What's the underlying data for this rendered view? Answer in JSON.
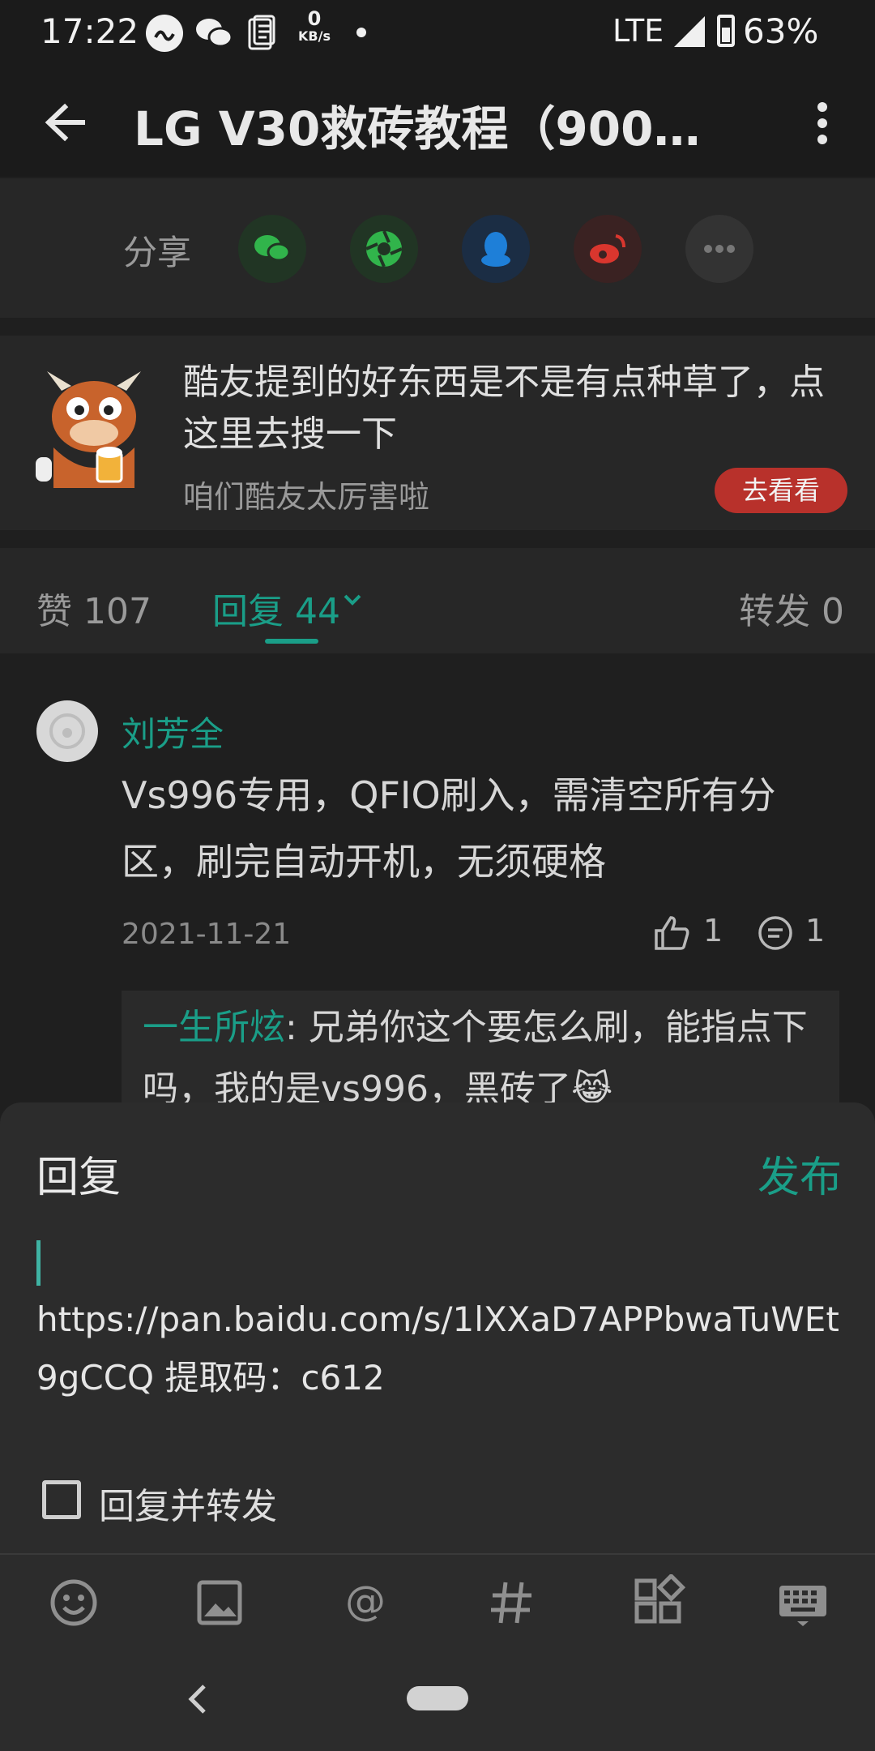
{
  "status_bar": {
    "time": "17:22",
    "net_speed_value": "0",
    "net_speed_unit": "KB/s",
    "network": "LTE",
    "battery": "63%"
  },
  "app_bar": {
    "title": "LG V30救砖教程（9008..."
  },
  "share": {
    "label": "分享",
    "targets": [
      "wechat",
      "moments",
      "qq",
      "weibo",
      "more"
    ]
  },
  "promo": {
    "text": "酷友提到的好东西是不是有点种草了，点这里去搜一下",
    "subtext": "咱们酷友太厉害啦",
    "button": "去看看"
  },
  "tabs": {
    "like": "赞 107",
    "reply": "回复 44",
    "forward": "转发 0"
  },
  "comment": {
    "author": "刘芳全",
    "text": "Vs996专用，QFIO刷入，需清空所有分区，刷完自动开机，无须硬格",
    "date": "2021-11-21",
    "likes": "1",
    "replies": "1",
    "sub_author": "一生所炫",
    "sub_text": ": 兄弟你这个要怎么刷，能指点下吗，我的是vs996，黑砖了😹"
  },
  "reply_sheet": {
    "title": "回复",
    "publish": "发布",
    "input_value": "https://pan.baidu.com/s/1lXXaD7APPbwaTuWEt9gCCQ 提取码：c612",
    "checkbox_label": "回复并转发"
  },
  "colors": {
    "accent": "#1a9e88",
    "promo_button": "#b8312b",
    "background": "#1f1f1f"
  }
}
